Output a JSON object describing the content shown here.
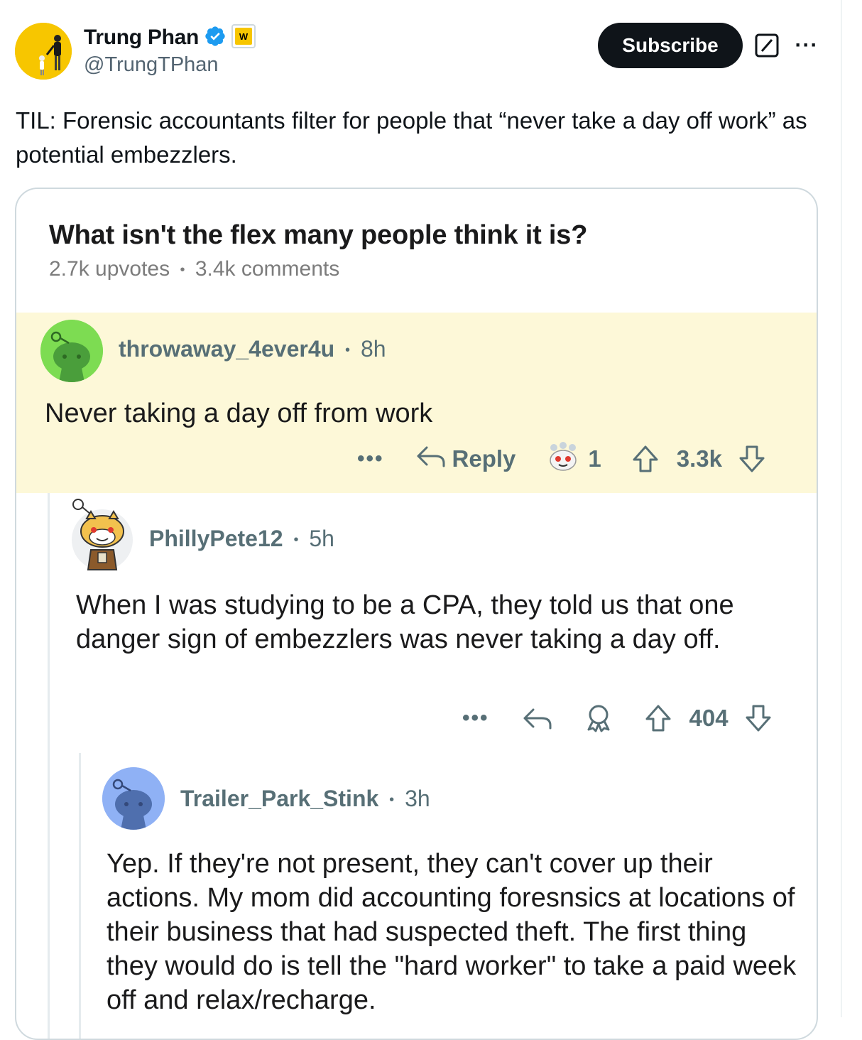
{
  "tweet": {
    "author_name": "Trung Phan",
    "author_handle": "@TrungTPhan",
    "subscribe_label": "Subscribe",
    "more_label": "···",
    "text": "TIL: Forensic accountants filter for people that “never take a day off work” as potential embezzlers."
  },
  "reddit": {
    "title": "What isn't the flex many people think it is?",
    "upvotes": "2.7k upvotes",
    "comments_count": "3.4k comments",
    "meta_sep": "•",
    "comments": [
      {
        "user": "throwaway_4ever4u",
        "time": "8h",
        "body": "Never taking a day off from work",
        "reply_label": "Reply",
        "award_count": "1",
        "score": "3.3k"
      },
      {
        "user": "PhillyPete12",
        "time": "5h",
        "body": "When I was studying to be a CPA, they told us that one danger sign of embezzlers was never taking a day off.",
        "score": "404"
      },
      {
        "user": "Trailer_Park_Stink",
        "time": "3h",
        "body": "Yep. If they're not present, they can't cover up their actions. My mom did accounting foresnsics at locations of their business that had suspected theft. The first thing they would do is tell the \"hard worker\" to take a paid week off and relax/recharge."
      }
    ]
  },
  "icons": {
    "verified": "verified-badge-icon",
    "affiliate": "affiliate-badge-icon",
    "grok": "grok-icon",
    "reply": "reply-arrow-icon",
    "award": "award-icon",
    "upvote": "upvote-arrow-icon",
    "downvote": "downvote-arrow-icon"
  },
  "colors": {
    "verified_blue": "#1d9bf0",
    "highlight_bg": "#fdf8d8",
    "reddit_meta": "#576f76",
    "green_avatar": "#7ddc52",
    "blue_avatar": "#8fb1f5"
  }
}
